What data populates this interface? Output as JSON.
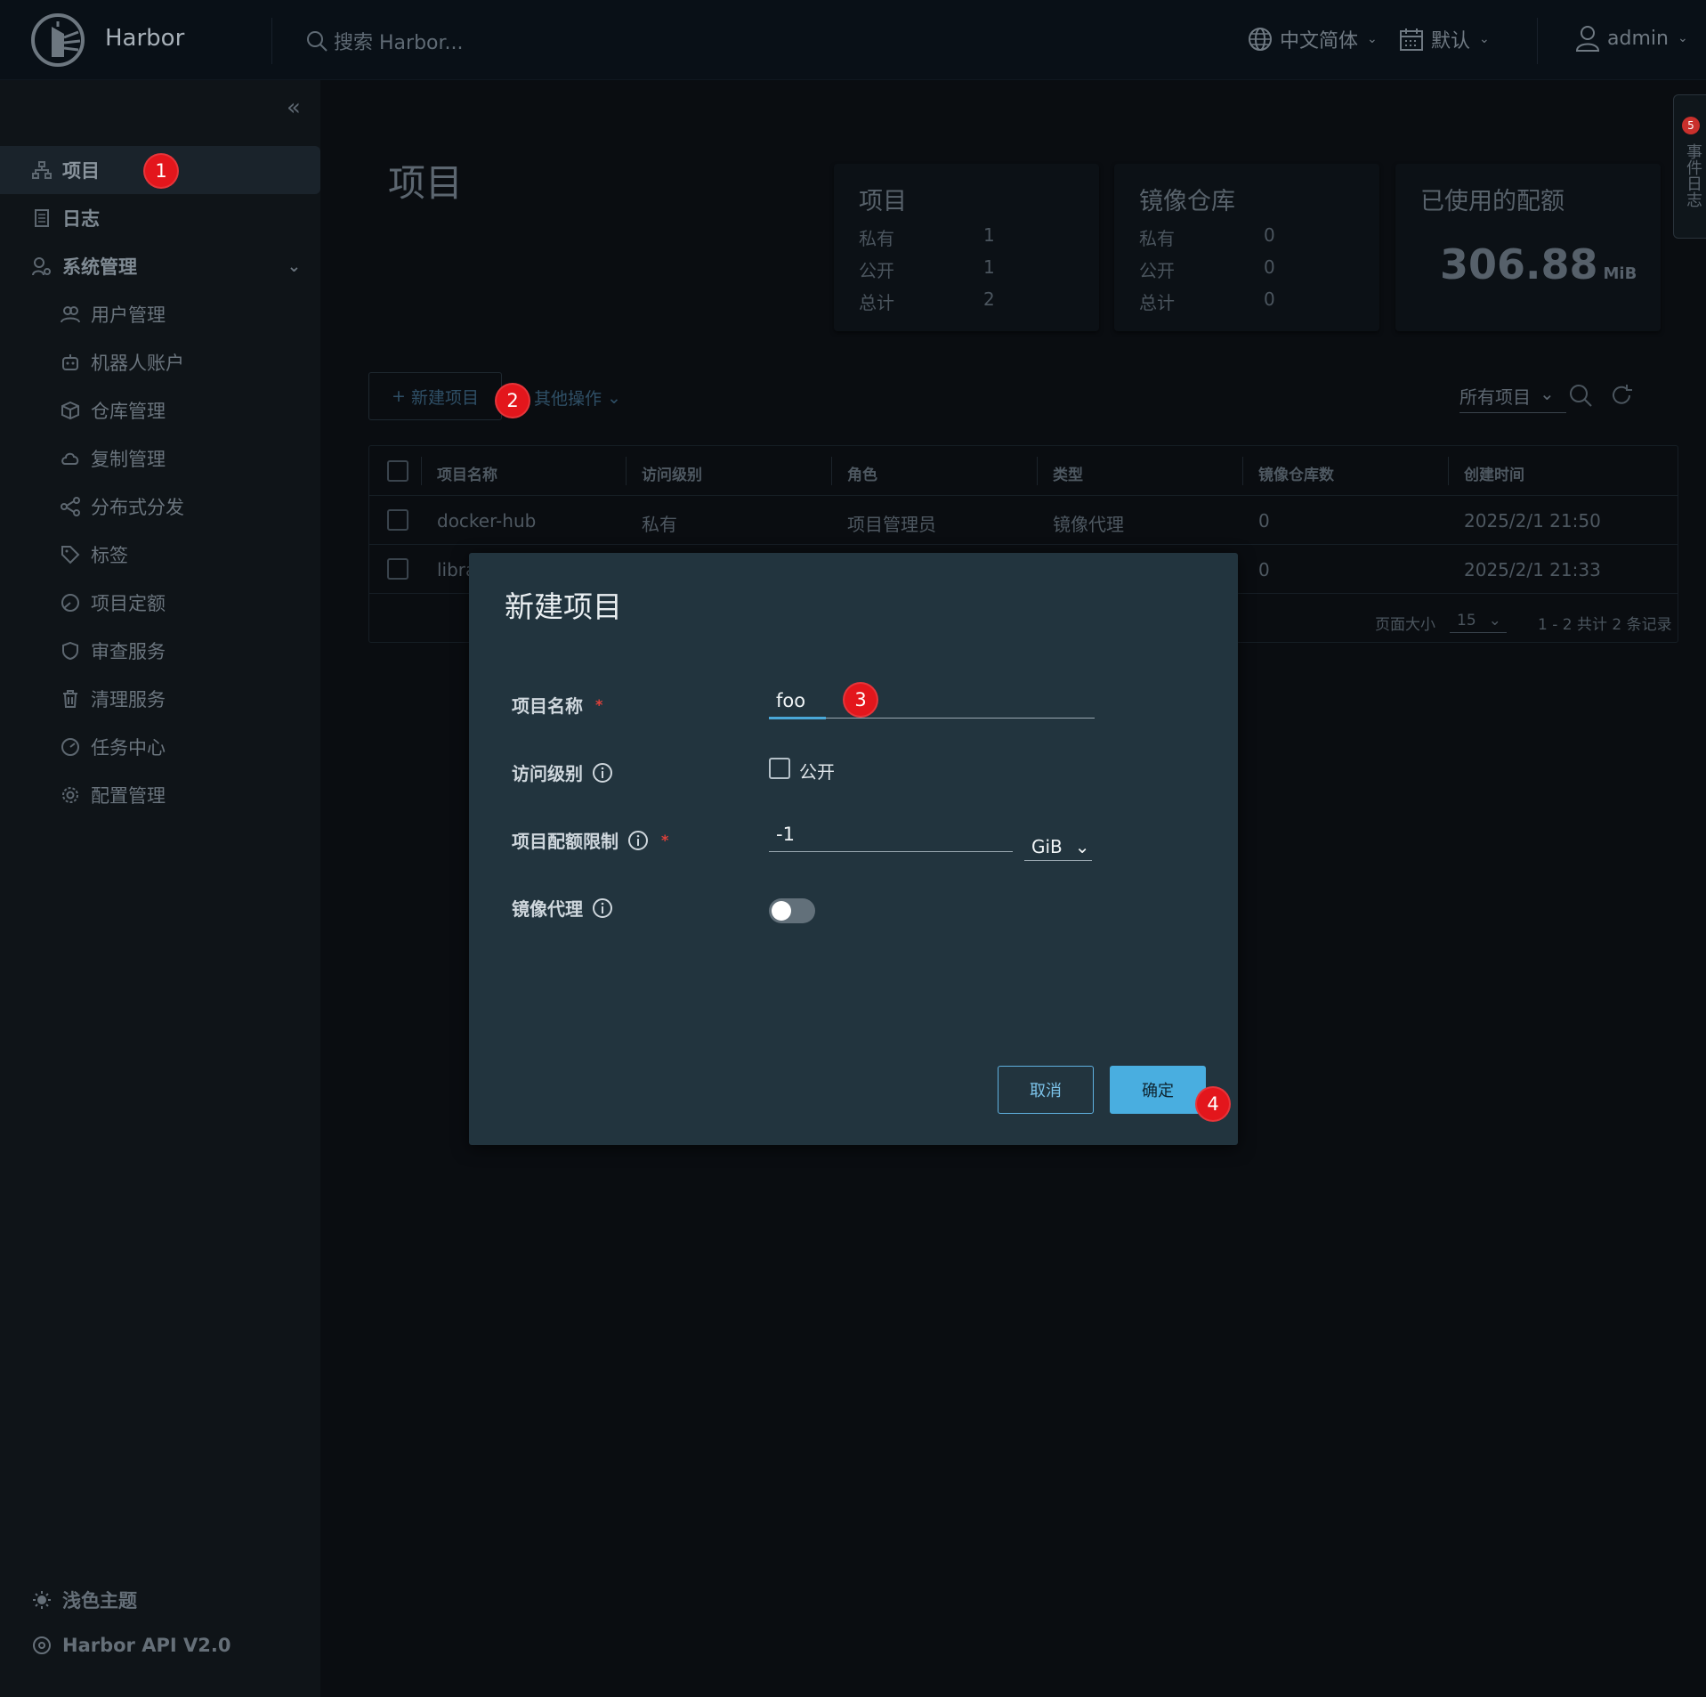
{
  "header": {
    "brand": "Harbor",
    "search_placeholder": "搜索 Harbor...",
    "language": "中文简体",
    "datetime_format": "默认",
    "user": "admin"
  },
  "sidebar": {
    "items": [
      {
        "label": "项目",
        "icon": "projects-icon"
      },
      {
        "label": "日志",
        "icon": "logs-icon"
      },
      {
        "label": "系统管理",
        "icon": "admin-icon"
      }
    ],
    "sub_items": [
      {
        "label": "用户管理",
        "icon": "users-icon"
      },
      {
        "label": "机器人账户",
        "icon": "robot-icon"
      },
      {
        "label": "仓库管理",
        "icon": "registry-icon"
      },
      {
        "label": "复制管理",
        "icon": "replication-icon"
      },
      {
        "label": "分布式分发",
        "icon": "distribution-icon"
      },
      {
        "label": "标签",
        "icon": "tag-icon"
      },
      {
        "label": "项目定额",
        "icon": "quota-icon"
      },
      {
        "label": "审查服务",
        "icon": "shield-icon"
      },
      {
        "label": "清理服务",
        "icon": "trash-icon"
      },
      {
        "label": "任务中心",
        "icon": "dashboard-icon"
      },
      {
        "label": "配置管理",
        "icon": "gear-icon"
      }
    ],
    "light_theme": "浅色主题",
    "api_link": "Harbor API V2.0"
  },
  "page": {
    "title": "项目",
    "stats": {
      "projects": {
        "title": "项目",
        "private_label": "私有",
        "private": "1",
        "public_label": "公开",
        "public": "1",
        "total_label": "总计",
        "total": "2"
      },
      "repos": {
        "title": "镜像仓库",
        "private_label": "私有",
        "private": "0",
        "public_label": "公开",
        "public": "0",
        "total_label": "总计",
        "total": "0"
      },
      "quota": {
        "title": "已使用的配额",
        "value": "306.88",
        "unit": "MiB"
      }
    },
    "toolbar": {
      "new_project": "新建项目",
      "other_actions": "其他操作",
      "filter": "所有项目"
    },
    "table": {
      "headers": [
        "项目名称",
        "访问级别",
        "角色",
        "类型",
        "镜像仓库数",
        "创建时间"
      ],
      "rows": [
        [
          "docker-hub",
          "私有",
          "项目管理员",
          "镜像代理",
          "0",
          "2025/2/1 21:50"
        ],
        [
          "libra",
          "",
          "",
          "",
          "0",
          "2025/2/1 21:33"
        ]
      ],
      "page_size_label": "页面大小",
      "page_size": "15",
      "pagination": "1 - 2 共计 2 条记录"
    }
  },
  "modal": {
    "title": "新建项目",
    "name_label": "项目名称",
    "name_value": "foo",
    "access_label": "访问级别",
    "public_label": "公开",
    "quota_label": "项目配额限制",
    "quota_value": "-1",
    "quota_unit": "GiB",
    "proxy_label": "镜像代理",
    "cancel": "取消",
    "ok": "确定"
  },
  "annotations": [
    "1",
    "2",
    "3",
    "4"
  ],
  "edge_tab": {
    "badge": "5",
    "label": "事件日志"
  }
}
